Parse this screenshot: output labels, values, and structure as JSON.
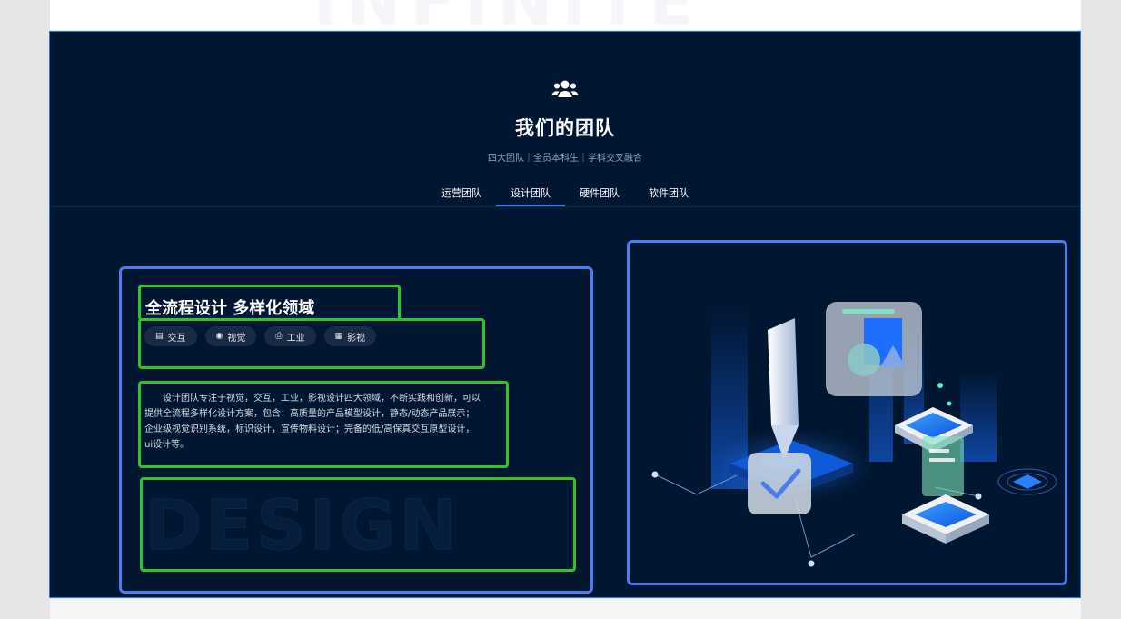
{
  "background_word": "INFINITE",
  "header": {
    "icon": "team-icon",
    "title": "我们的团队",
    "subtitle": "四大团队｜全员本科生｜学科交叉融合"
  },
  "tabs": [
    {
      "label": "运营团队",
      "active": false
    },
    {
      "label": "设计团队",
      "active": true
    },
    {
      "label": "硬件团队",
      "active": false
    },
    {
      "label": "软件团队",
      "active": false
    }
  ],
  "content": {
    "heading": "全流程设计 多样化领域",
    "chips": [
      {
        "icon": "calendar-icon",
        "glyph": "▤",
        "label": "交互"
      },
      {
        "icon": "eye-icon",
        "glyph": "◉",
        "label": "视觉"
      },
      {
        "icon": "printer-icon",
        "glyph": "⎙",
        "label": "工业"
      },
      {
        "icon": "film-icon",
        "glyph": "▦",
        "label": "影视"
      }
    ],
    "description": "设计团队专注于视觉，交互，工业，影视设计四大领域，不断实践和创新，可以提供全流程多样化设计方案，包含：高质量的产品模型设计，静态/动态产品展示；企业级视觉识别系统，标识设计，宣传物料设计；完备的低/高保真交互原型设计，ui设计等。",
    "watermark": "DESIGN"
  },
  "colors": {
    "panel_bg": "#011631",
    "accent": "#2a7fff",
    "annotation_blue": "#4a7cf0",
    "annotation_green": "#2fc32a"
  }
}
